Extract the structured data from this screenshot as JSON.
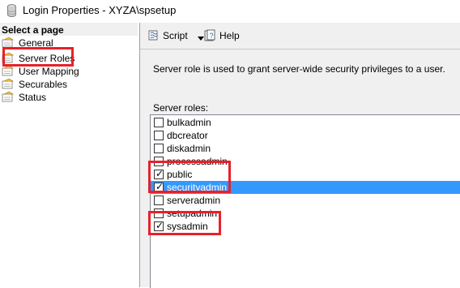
{
  "window": {
    "title": "Login Properties - XYZA\\spsetup"
  },
  "left_pane": {
    "header": "Select a page",
    "items": [
      {
        "label": "General",
        "icon": "page-icon"
      },
      {
        "label": "Server Roles",
        "icon": "page-icon"
      },
      {
        "label": "User Mapping",
        "icon": "page-icon"
      },
      {
        "label": "Securables",
        "icon": "page-icon"
      },
      {
        "label": "Status",
        "icon": "page-icon"
      }
    ]
  },
  "toolbar": {
    "script_label": "Script",
    "help_label": "Help"
  },
  "content": {
    "description": "Server role is used to grant server-wide security privileges to a user.",
    "roles_label": "Server roles:",
    "roles": [
      {
        "name": "bulkadmin",
        "checked": false
      },
      {
        "name": "dbcreator",
        "checked": false
      },
      {
        "name": "diskadmin",
        "checked": false
      },
      {
        "name": "processadmin",
        "checked": false
      },
      {
        "name": "public",
        "checked": true
      },
      {
        "name": "securityadmin",
        "checked": true,
        "selected": true
      },
      {
        "name": "serveradmin",
        "checked": false
      },
      {
        "name": "setupadmin",
        "checked": false
      },
      {
        "name": "sysadmin",
        "checked": true
      }
    ]
  },
  "colors": {
    "selection": "#3399ff",
    "annotation": "#e8202a",
    "panel": "#f0f0f0"
  }
}
